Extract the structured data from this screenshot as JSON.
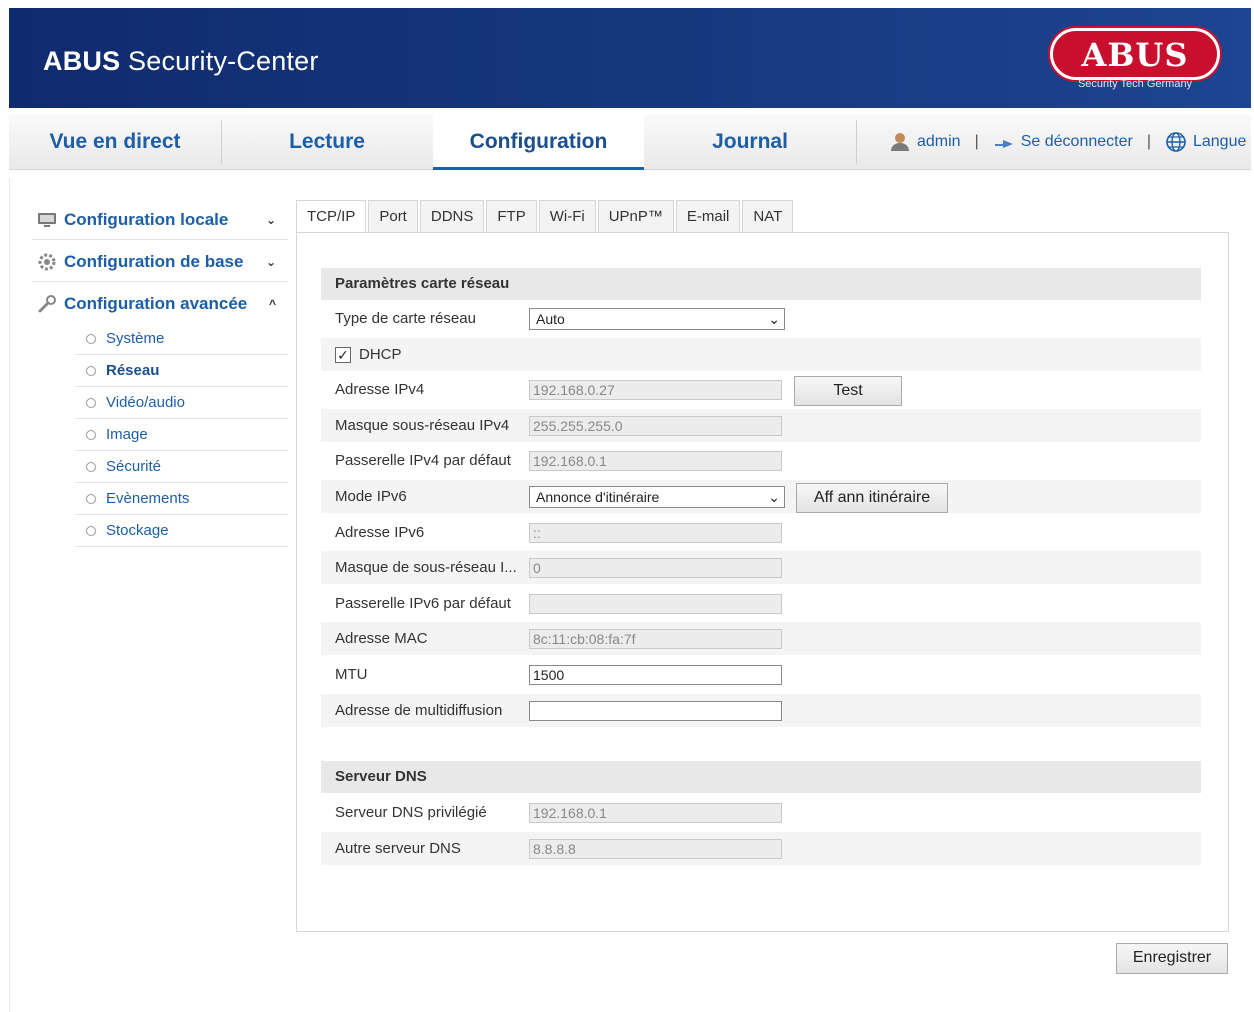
{
  "header": {
    "title_bold": "ABUS",
    "title_rest": " Security-Center",
    "logo_text": "ABUS",
    "logo_sub": "Security Tech Germany"
  },
  "nav": {
    "tabs": [
      "Vue en direct",
      "Lecture",
      "Configuration",
      "Journal"
    ],
    "active": "Configuration",
    "user": "admin",
    "logout": "Se déconnecter",
    "language": "Langue",
    "separator": "|"
  },
  "sidebar": {
    "sections": [
      {
        "label": "Configuration locale",
        "icon": "monitor-icon",
        "caret": "⌄"
      },
      {
        "label": "Configuration de base",
        "icon": "gear-icon",
        "caret": "⌄"
      },
      {
        "label": "Configuration avancée",
        "icon": "wrench-icon",
        "caret": "^"
      }
    ],
    "items": [
      "Système",
      "Réseau",
      "Vidéo/audio",
      "Image",
      "Sécurité",
      "Evènements",
      "Stockage"
    ],
    "active_item": "Réseau"
  },
  "tabs": [
    "TCP/IP",
    "Port",
    "DDNS",
    "FTP",
    "Wi-Fi",
    "UPnP™",
    "E-mail",
    "NAT"
  ],
  "active_tab": "TCP/IP",
  "network": {
    "section_title": "Paramètres carte réseau",
    "nic_type_label": "Type de carte réseau",
    "nic_type_value": "Auto",
    "dhcp_label": "DHCP",
    "dhcp_checked": "✓",
    "ipv4_label": "Adresse IPv4",
    "ipv4_value": "192.168.0.27",
    "test_button": "Test",
    "mask_label": "Masque sous-réseau IPv4",
    "mask_value": "255.255.255.0",
    "gateway_label": "Passerelle IPv4 par défaut",
    "gateway_value": "192.168.0.1",
    "ipv6_mode_label": "Mode IPv6",
    "ipv6_mode_value": "Annonce d'itinéraire",
    "route_button": "Aff ann itinéraire",
    "ipv6_label": "Adresse IPv6",
    "ipv6_value": "::",
    "ipv6_mask_label": "Masque de sous-réseau I...",
    "ipv6_mask_value": "0",
    "ipv6_gateway_label": "Passerelle IPv6 par défaut",
    "ipv6_gateway_value": "",
    "mac_label": "Adresse MAC",
    "mac_value": "8c:11:cb:08:fa:7f",
    "mtu_label": "MTU",
    "mtu_value": "1500",
    "multicast_label": "Adresse de multidiffusion",
    "multicast_value": ""
  },
  "dns": {
    "section_title": "Serveur DNS",
    "preferred_label": "Serveur DNS privilégié",
    "preferred_value": "192.168.0.1",
    "alternate_label": "Autre serveur DNS",
    "alternate_value": "8.8.8.8"
  },
  "save_button": "Enregistrer"
}
